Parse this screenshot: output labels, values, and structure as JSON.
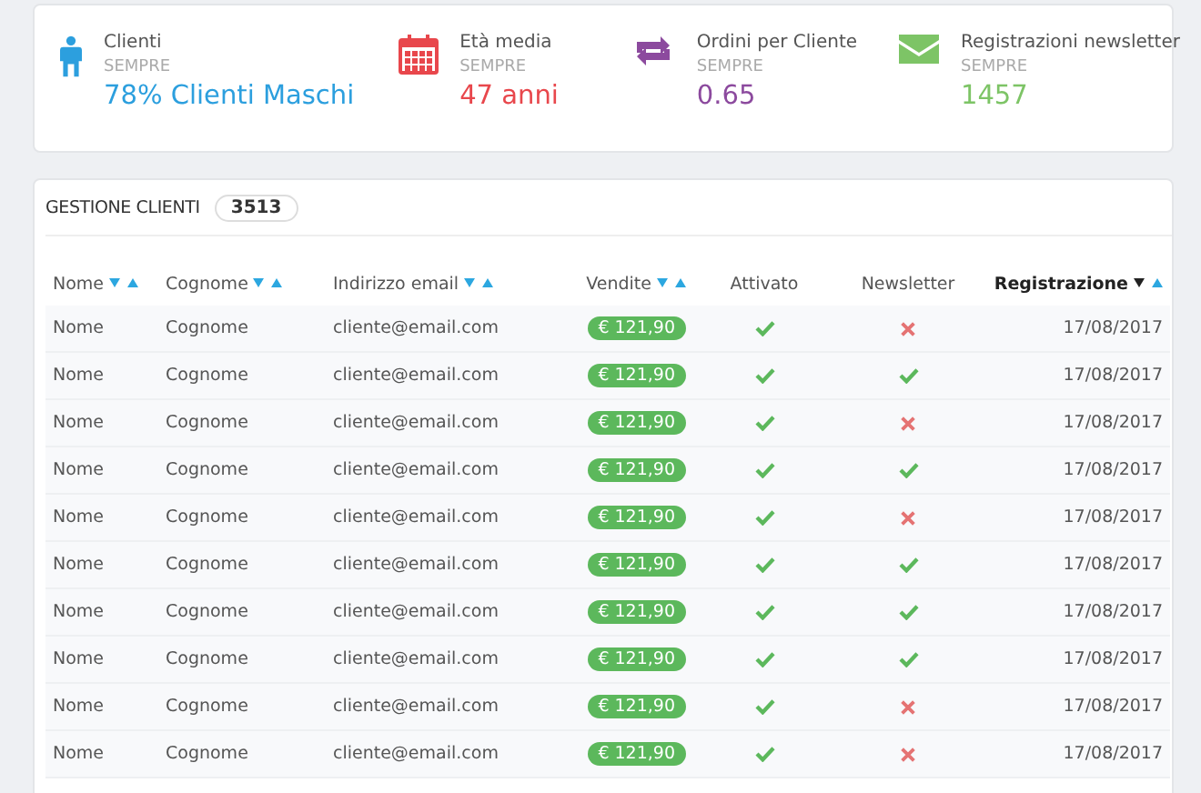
{
  "stats": [
    {
      "kind": "person",
      "label": "Clienti",
      "period": "SEMPRE",
      "value": "78% Clienti Maschi",
      "color": "#2c9fde"
    },
    {
      "kind": "calendar",
      "label": "Età media",
      "period": "SEMPRE",
      "value": "47 anni",
      "color": "#e8474c"
    },
    {
      "kind": "repeat",
      "label": "Ordini per Cliente",
      "period": "SEMPRE",
      "value": "0.65",
      "color": "#8c4a9e"
    },
    {
      "kind": "mail",
      "label": "Registrazioni newsletter",
      "period": "SEMPRE",
      "value": "1457",
      "color": "#7dc466"
    }
  ],
  "table": {
    "title": "GESTIONE CLIENTI",
    "count": "3513",
    "columns": [
      {
        "label": "Nome",
        "sortable": true,
        "selected": false
      },
      {
        "label": "Cognome",
        "sortable": true,
        "selected": false
      },
      {
        "label": "Indirizzo email",
        "sortable": true,
        "selected": false
      },
      {
        "label": "Vendite",
        "sortable": true,
        "selected": false
      },
      {
        "label": "Attivato",
        "sortable": false,
        "selected": false
      },
      {
        "label": "Newsletter",
        "sortable": false,
        "selected": false
      },
      {
        "label": "Registrazione",
        "sortable": true,
        "selected": true
      }
    ],
    "rows": [
      {
        "name": "Nome",
        "surname": "Cognome",
        "email": "cliente@email.com",
        "sales": "€ 121,90",
        "activated": true,
        "newsletter": false,
        "date": "17/08/2017"
      },
      {
        "name": "Nome",
        "surname": "Cognome",
        "email": "cliente@email.com",
        "sales": "€ 121,90",
        "activated": true,
        "newsletter": true,
        "date": "17/08/2017"
      },
      {
        "name": "Nome",
        "surname": "Cognome",
        "email": "cliente@email.com",
        "sales": "€ 121,90",
        "activated": true,
        "newsletter": false,
        "date": "17/08/2017"
      },
      {
        "name": "Nome",
        "surname": "Cognome",
        "email": "cliente@email.com",
        "sales": "€ 121,90",
        "activated": true,
        "newsletter": true,
        "date": "17/08/2017"
      },
      {
        "name": "Nome",
        "surname": "Cognome",
        "email": "cliente@email.com",
        "sales": "€ 121,90",
        "activated": true,
        "newsletter": false,
        "date": "17/08/2017"
      },
      {
        "name": "Nome",
        "surname": "Cognome",
        "email": "cliente@email.com",
        "sales": "€ 121,90",
        "activated": true,
        "newsletter": true,
        "date": "17/08/2017"
      },
      {
        "name": "Nome",
        "surname": "Cognome",
        "email": "cliente@email.com",
        "sales": "€ 121,90",
        "activated": true,
        "newsletter": true,
        "date": "17/08/2017"
      },
      {
        "name": "Nome",
        "surname": "Cognome",
        "email": "cliente@email.com",
        "sales": "€ 121,90",
        "activated": true,
        "newsletter": true,
        "date": "17/08/2017"
      },
      {
        "name": "Nome",
        "surname": "Cognome",
        "email": "cliente@email.com",
        "sales": "€ 121,90",
        "activated": true,
        "newsletter": false,
        "date": "17/08/2017"
      },
      {
        "name": "Nome",
        "surname": "Cognome",
        "email": "cliente@email.com",
        "sales": "€ 121,90",
        "activated": true,
        "newsletter": false,
        "date": "17/08/2017"
      }
    ]
  }
}
